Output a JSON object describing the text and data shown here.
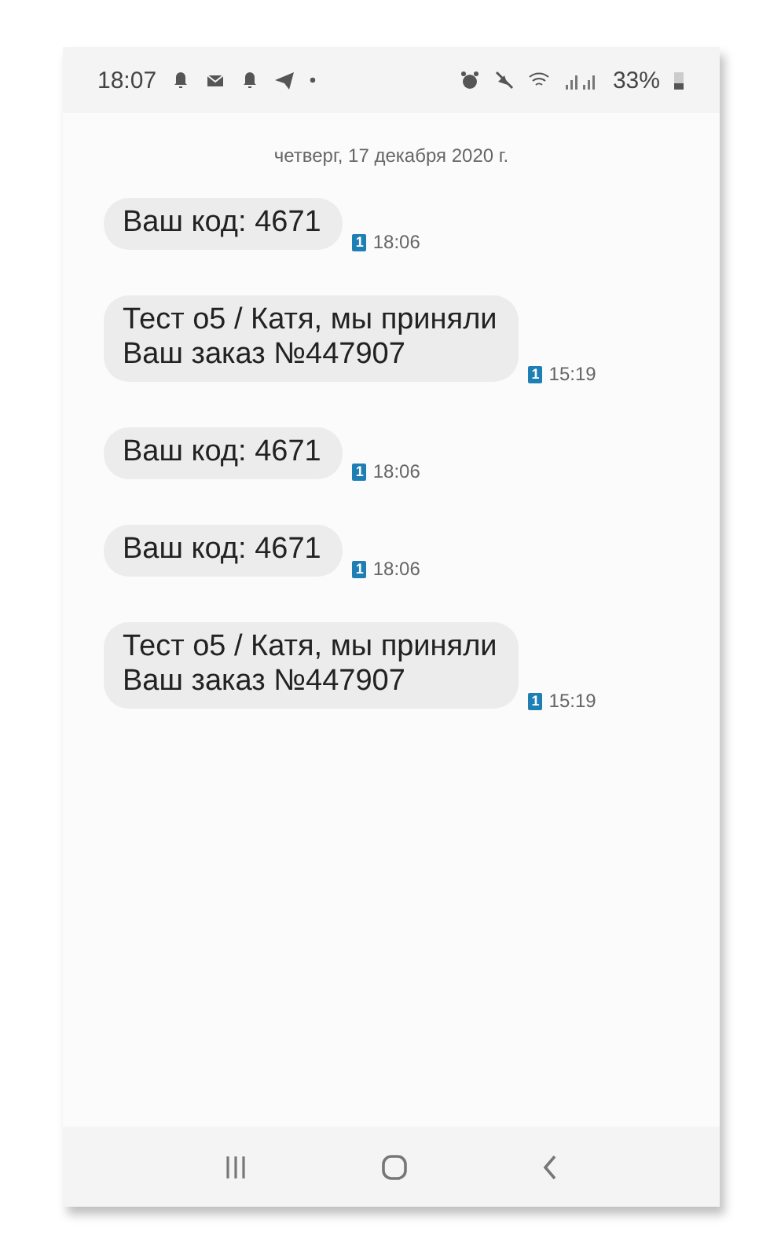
{
  "status_bar": {
    "time": "18:07",
    "battery": "33%"
  },
  "date_header": "четверг, 17 декабря 2020 г.",
  "messages": [
    {
      "text": "Ваш код: 4671",
      "sim": "1",
      "time": "18:06"
    },
    {
      "text": "Тест о5 / Катя, мы приняли\nВаш заказ №447907",
      "sim": "1",
      "time": "15:19"
    },
    {
      "text": "Ваш код: 4671",
      "sim": "1",
      "time": "18:06"
    },
    {
      "text": "Ваш код: 4671",
      "sim": "1",
      "time": "18:06"
    },
    {
      "text": "Тест о5 / Катя, мы приняли\nВаш заказ №447907",
      "sim": "1",
      "time": "15:19"
    }
  ]
}
